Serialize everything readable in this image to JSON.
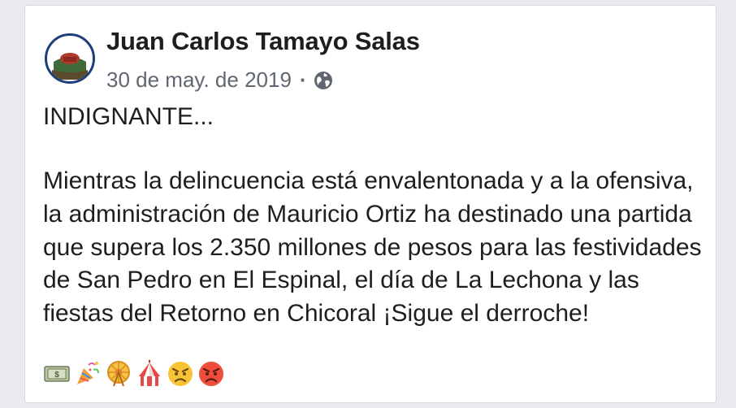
{
  "post": {
    "author": "Juan Carlos Tamayo Salas",
    "date": "30 de may. de 2019",
    "separator": "·",
    "title": "INDIGNANTE...",
    "body": "Mientras la delincuencia está envalentonada y a la ofensiva, la administración de Mauricio Ortiz ha destinado una partida que supera los 2.350 millones de pesos para las festividades de San Pedro en El Espinal, el día de La Lechona y las fiestas del Retorno en Chicoral ¡Sigue el derroche!",
    "emojis": [
      "money-icon",
      "party-popper-icon",
      "ferris-wheel-icon",
      "circus-tent-icon",
      "angry-face-icon",
      "pouting-face-icon"
    ]
  },
  "colors": {
    "author_text": "#1c1e21",
    "meta_text": "#606770",
    "avatar_ring": "#1f3f7a",
    "card_bg": "#ffffff"
  }
}
